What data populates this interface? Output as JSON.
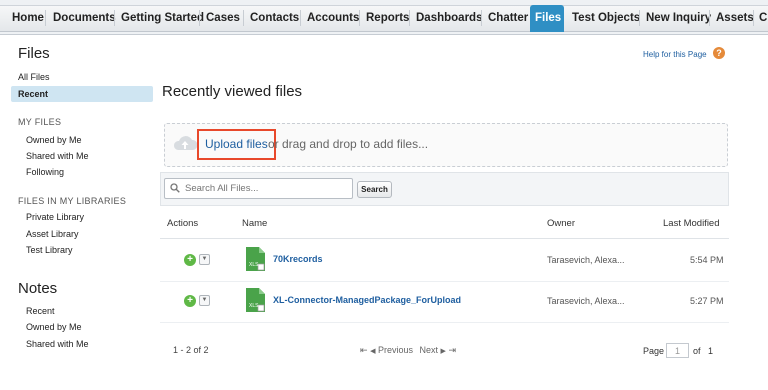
{
  "nav": {
    "tabs": [
      {
        "label": "Home"
      },
      {
        "label": "Documents"
      },
      {
        "label": "Getting Started"
      },
      {
        "label": "Cases"
      },
      {
        "label": "Contacts"
      },
      {
        "label": "Accounts"
      },
      {
        "label": "Reports"
      },
      {
        "label": "Dashboards"
      },
      {
        "label": "Chatter"
      },
      {
        "label": "Files",
        "active": true
      },
      {
        "label": "Test Objects"
      },
      {
        "label": "New Inquiry"
      },
      {
        "label": "Assets"
      },
      {
        "label": "C"
      }
    ]
  },
  "sidebar": {
    "files_title": "Files",
    "all_files": "All Files",
    "recent": "Recent",
    "my_files_heading": "MY FILES",
    "owned_by_me": "Owned by Me",
    "shared_with_me": "Shared with Me",
    "following": "Following",
    "libraries_heading": "FILES IN MY LIBRARIES",
    "private_library": "Private Library",
    "asset_library": "Asset Library",
    "test_library": "Test Library",
    "notes_title": "Notes",
    "notes_recent": "Recent",
    "notes_owned": "Owned by Me",
    "notes_shared": "Shared with Me"
  },
  "main": {
    "help_link": "Help for this Page",
    "help_icon": "?",
    "title": "Recently viewed files",
    "upload_link": "Upload files",
    "upload_rest": "or drag and drop to add files...",
    "search_placeholder": "Search All Files...",
    "search_button": "Search",
    "columns": {
      "actions": "Actions",
      "name": "Name",
      "owner": "Owner",
      "last_modified": "Last Modified"
    },
    "rows": [
      {
        "name": "70Krecords",
        "owner": "Tarasevich, Alexa...",
        "modified": "5:54 PM"
      },
      {
        "name": "XL-Connector-ManagedPackage_ForUpload",
        "owner": "Tarasevich, Alexa...",
        "modified": "5:27 PM"
      }
    ],
    "pager": {
      "count": "1 - 2 of 2",
      "first": "⇤",
      "prev_arrow": "◀",
      "previous": "Previous",
      "next": "Next",
      "next_arrow": "▶",
      "last": "⇥",
      "page_label": "Page",
      "page_value": "1",
      "of_label": "of",
      "total_pages": "1"
    }
  },
  "colors": {
    "accent": "#2f8fc4",
    "link": "#1f5fa0",
    "upload_highlight": "#e8482b",
    "file_icon_green": "#4aa34a",
    "add_green": "#5fb846"
  },
  "icons": {
    "help": "help-icon",
    "cloud": "cloud-upload-icon",
    "search": "search-icon",
    "add": "plus-icon",
    "dropdown": "chevron-down-icon",
    "file": "excel-file-icon"
  }
}
